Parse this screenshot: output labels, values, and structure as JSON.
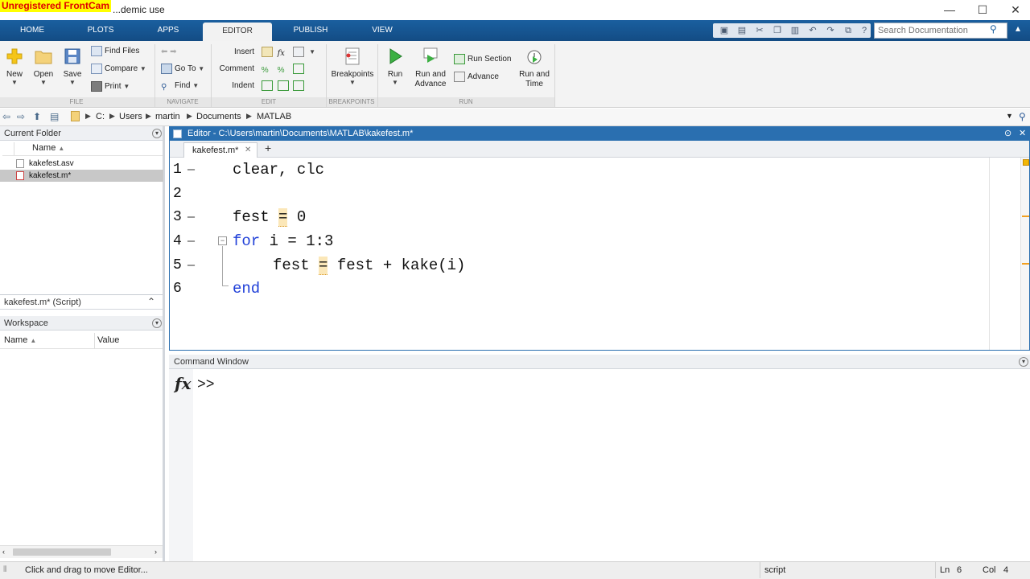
{
  "watermark": "Unregistered FrontCam",
  "window": {
    "title": "...demic use",
    "min": "—",
    "max": "☐",
    "close": "✕"
  },
  "tabs": [
    "HOME",
    "PLOTS",
    "APPS",
    "EDITOR",
    "PUBLISH",
    "VIEW"
  ],
  "search": {
    "placeholder": "Search Documentation"
  },
  "ribbon": {
    "file": {
      "new": "New",
      "open": "Open",
      "save": "Save",
      "find_files": "Find Files",
      "compare": "Compare",
      "print": "Print",
      "label": "FILE"
    },
    "navigate": {
      "go_to": "Go To",
      "find": "Find",
      "label": "NAVIGATE"
    },
    "edit": {
      "insert": "Insert",
      "comment": "Comment",
      "indent": "Indent",
      "label": "EDIT"
    },
    "breakpoints": {
      "breakpoints": "Breakpoints",
      "label": "BREAKPOINTS"
    },
    "run": {
      "run": "Run",
      "run_and_advance": "Run and Advance",
      "run_section": "Run Section",
      "advance": "Advance",
      "run_and_time": "Run and Time",
      "label": "RUN"
    }
  },
  "address": {
    "crumbs": [
      "C:",
      "Users",
      "martin",
      "Documents",
      "MATLAB"
    ]
  },
  "current_folder": {
    "title": "Current Folder",
    "col_name": "Name",
    "files": [
      "kakefest.asv",
      "kakefest.m*"
    ],
    "details": "kakefest.m* (Script)"
  },
  "workspace": {
    "title": "Workspace",
    "col_name": "Name",
    "col_value": "Value"
  },
  "editor": {
    "title": "Editor - C:\\Users\\martin\\Documents\\MATLAB\\kakefest.m*",
    "tab": "kakefest.m*",
    "lines": [
      "1",
      "2",
      "3",
      "4",
      "5",
      "6"
    ],
    "code": {
      "l1": "clear, clc",
      "l3a": "fest ",
      "l3eq": "=",
      "l3b": " 0",
      "l4kw": "for",
      "l4": " i = 1:3",
      "l5a": "fest ",
      "l5eq": "=",
      "l5b": " fest + kake(i)",
      "l6kw": "end"
    }
  },
  "command_window": {
    "title": "Command Window",
    "fx": "fx",
    "prompt": ">>"
  },
  "status": {
    "message": "Click and drag to move Editor...",
    "type": "script",
    "ln_label": "Ln",
    "ln": "6",
    "col_label": "Col",
    "col": "4"
  }
}
